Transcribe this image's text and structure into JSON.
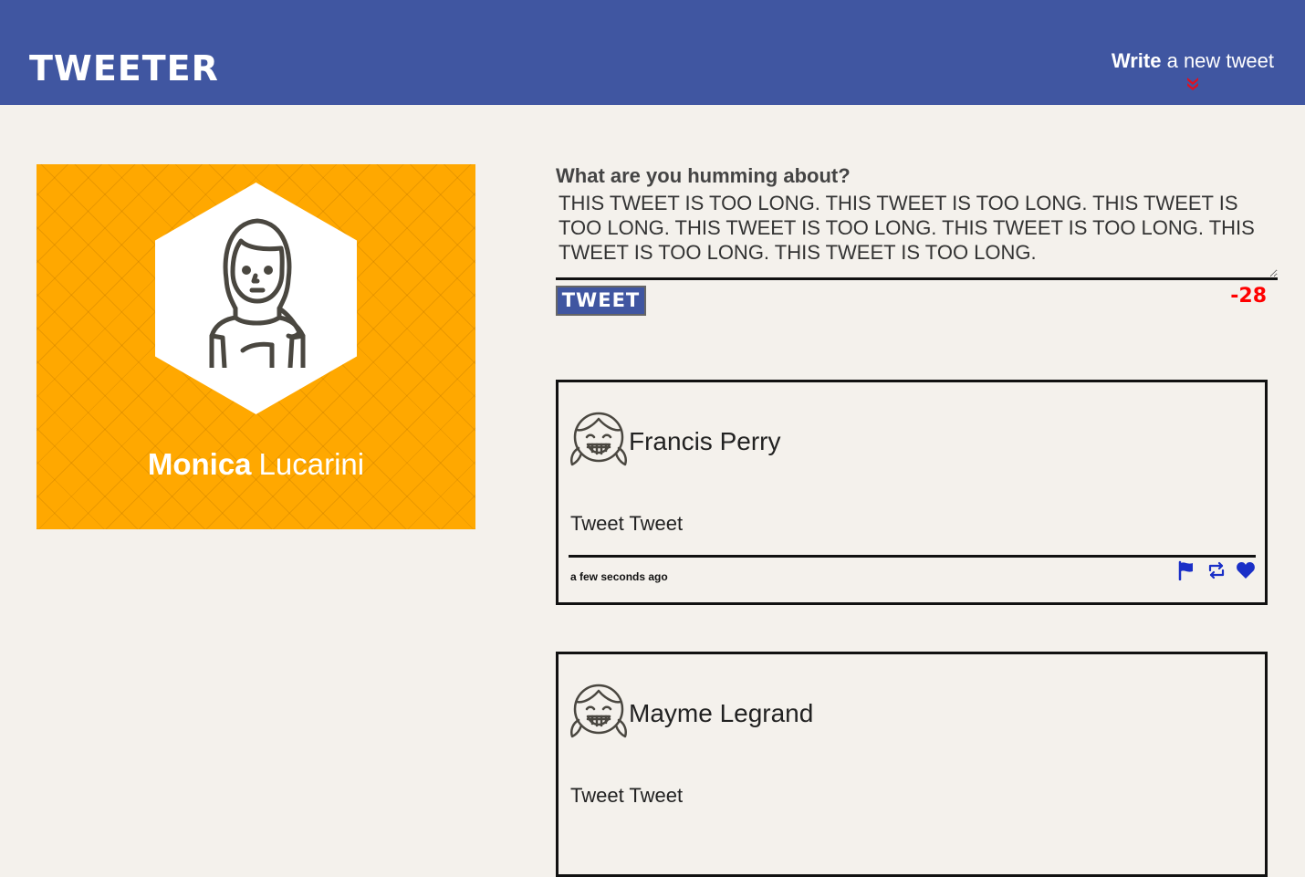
{
  "nav": {
    "brand": "TWEETER",
    "compose_bold": "Write",
    "compose_light": "a new tweet",
    "compose_icon": "chevron-double-down-icon"
  },
  "profile": {
    "first_name": "Monica",
    "last_name": "Lucarini",
    "avatar_icon": "woman-avatar-icon",
    "background_color": "#ffa800"
  },
  "composer": {
    "label": "What are you humming about?",
    "text": "THIS TWEET IS TOO LONG. THIS TWEET IS TOO LONG. THIS TWEET IS TOO LONG. THIS TWEET IS TOO LONG. THIS TWEET IS TOO LONG. THIS TWEET IS TOO LONG. THIS TWEET IS TOO LONG.",
    "button_label": "TWEET",
    "counter": "-28"
  },
  "tweets": [
    {
      "name": "Francis Perry",
      "avatar_icon": "girl-avatar-icon",
      "content": "Tweet Tweet",
      "time": "a few seconds ago",
      "actions": [
        "flag-icon",
        "retweet-icon",
        "heart-icon"
      ]
    },
    {
      "name": "Mayme Legrand",
      "avatar_icon": "girl-avatar-icon",
      "content": "Tweet Tweet",
      "time": "",
      "actions": []
    }
  ],
  "colors": {
    "nav": "#4056a1",
    "page_bg": "#f4f1ec",
    "profile_bg": "#ffa800",
    "counter_over": "#ff0000",
    "accent_icon": "#1a2fc7",
    "chevron": "#e01020"
  }
}
